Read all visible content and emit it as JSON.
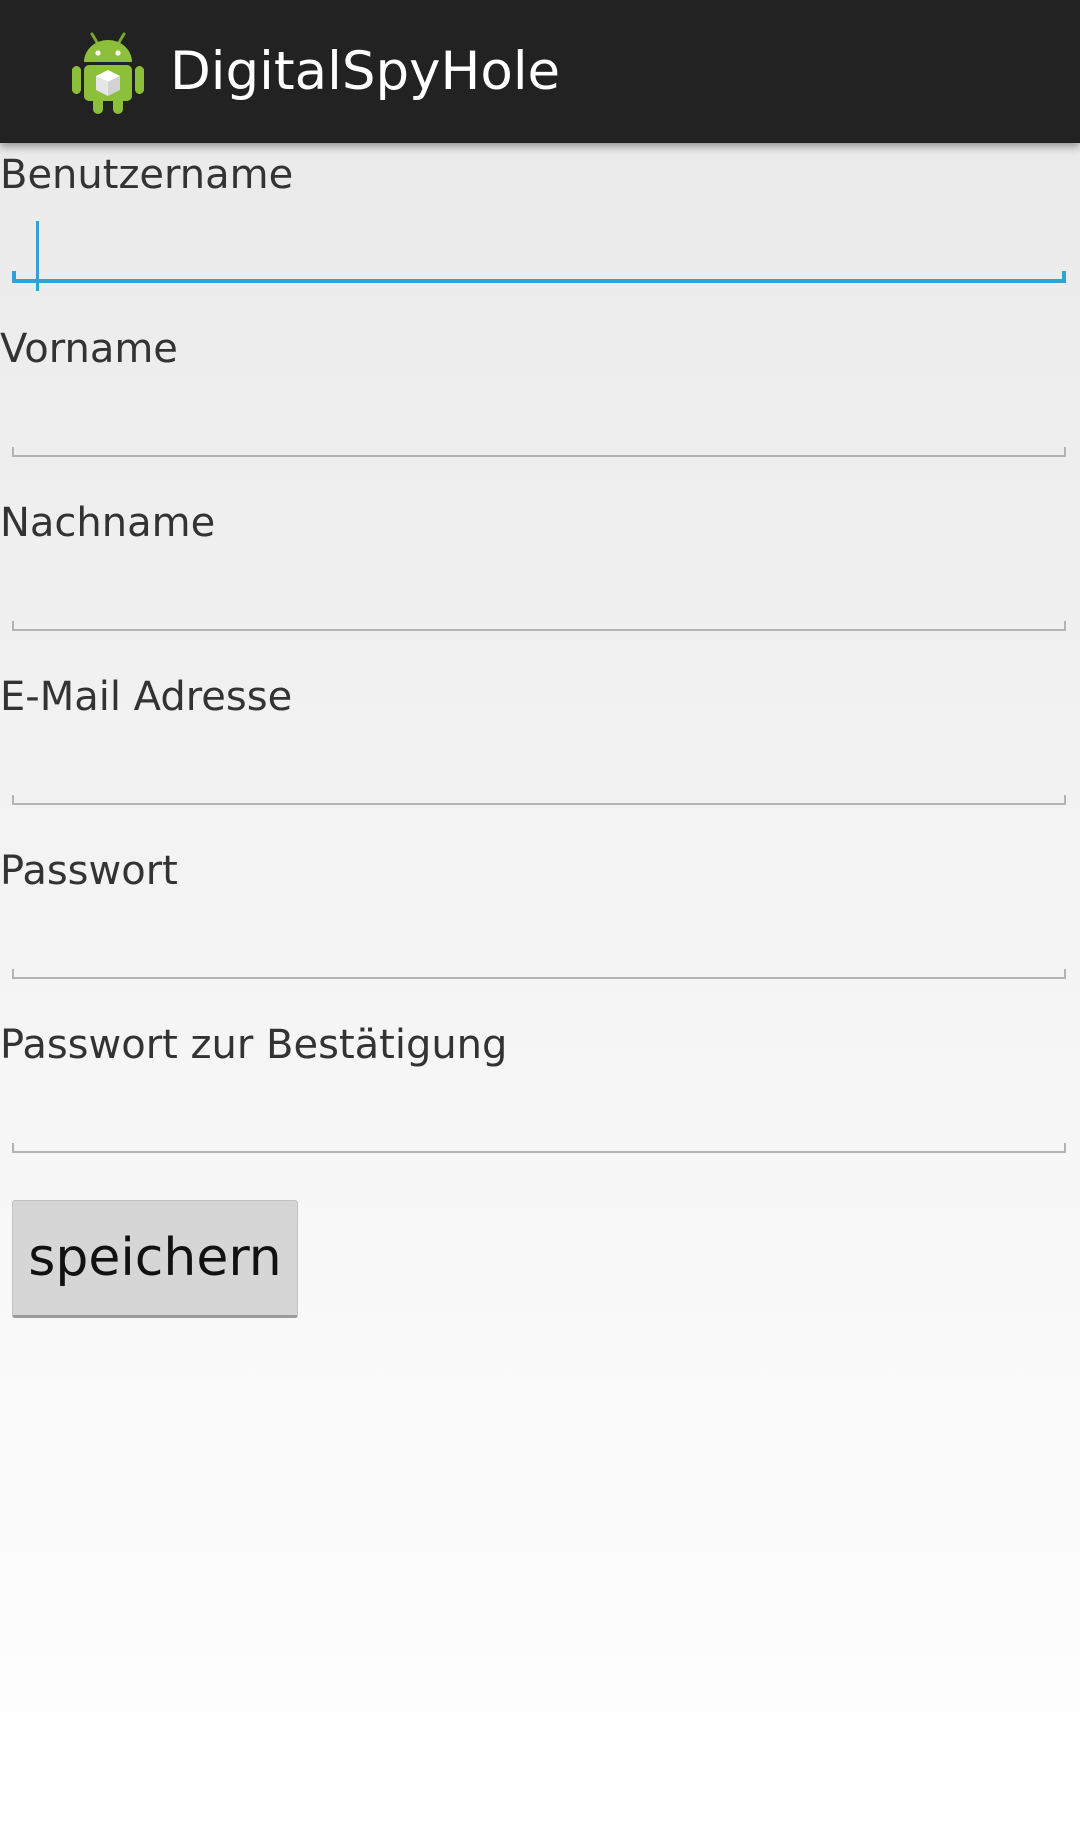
{
  "action_bar": {
    "title": "DigitalSpyHole",
    "icon": "android-app-icon"
  },
  "form": {
    "fields": [
      {
        "label": "Benutzername",
        "value": "",
        "focused": true
      },
      {
        "label": "Vorname",
        "value": ""
      },
      {
        "label": "Nachname",
        "value": ""
      },
      {
        "label": "E-Mail Adresse",
        "value": ""
      },
      {
        "label": "Passwort",
        "value": ""
      },
      {
        "label": "Passwort zur Bestätigung",
        "value": ""
      }
    ],
    "save_label": "speichern"
  },
  "colors": {
    "action_bar_bg": "#222222",
    "accent_focus": "#33a1d3",
    "button_bg": "#d6d6d6"
  }
}
